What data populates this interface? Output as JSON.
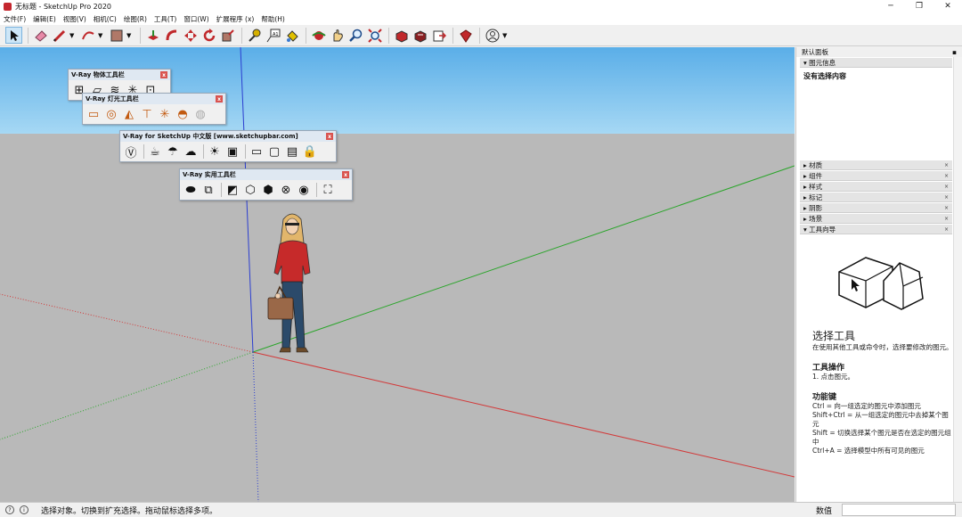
{
  "window": {
    "title": "无标题 - SketchUp Pro 2020",
    "minimize": "─",
    "restore": "❐",
    "close": "✕"
  },
  "menu": [
    "文件(F)",
    "编辑(E)",
    "视图(V)",
    "相机(C)",
    "绘图(R)",
    "工具(T)",
    "窗口(W)",
    "扩展程序 (x)",
    "帮助(H)"
  ],
  "toolbar": {
    "icons": [
      "select-icon",
      "eraser-icon",
      "pencil-icon",
      "arc-icon",
      "rectangle-icon",
      "push-pull-icon",
      "follow-me-icon",
      "move-icon",
      "rotate-icon",
      "scale-icon",
      "tape-measure-icon",
      "text-icon",
      "paint-bucket-icon",
      "orbit-icon",
      "pan-icon",
      "zoom-icon",
      "zoom-extents-icon",
      "warehouse-icon",
      "extension-warehouse-icon",
      "layout-icon",
      "ruby-icon",
      "account-icon"
    ]
  },
  "floating_toolbars": {
    "vray_object": {
      "title": "V-Ray 物体工具栏",
      "close": "x"
    },
    "vray_light": {
      "title": "V-Ray 灯光工具栏",
      "close": "x"
    },
    "vray_main": {
      "title": "V-Ray for SketchUp 中文版 [www.sketchupbar.com]",
      "close": "x"
    },
    "vray_utility": {
      "title": "V-Ray 实用工具栏",
      "close": "x"
    }
  },
  "panel": {
    "title": "默认面板",
    "pin": "📌",
    "close": "×",
    "entity_info": {
      "label": "图元信息",
      "body": "没有选择内容"
    },
    "trays": [
      "材质",
      "组件",
      "样式",
      "标记",
      "阴影",
      "场景"
    ],
    "instructor": {
      "label": "工具向导",
      "title": "选择工具",
      "desc": "在使用其他工具或命令时，选择要修改的图元。",
      "ops_title": "工具操作",
      "ops": [
        "1. 点击图元。"
      ],
      "keys_title": "功能键",
      "keys": [
        "Ctrl = 向一组选定的图元中添加图元",
        "Shift+Ctrl = 从一组选定的图元中去掉某个图元",
        "Shift = 切换选择某个图元是否在选定的图元组中",
        "Ctrl+A = 选择模型中所有可见的图元"
      ]
    }
  },
  "status": {
    "message": "选择对象。切换到扩充选择。拖动鼠标选择多项。",
    "measurements_label": "数值",
    "measurements_value": ""
  },
  "colors": {
    "sky": "#5aaee8",
    "ground": "#b9b9b9",
    "axis_red": "#d23a3a",
    "axis_green": "#2aa52a",
    "axis_blue": "#2b3ed0"
  }
}
